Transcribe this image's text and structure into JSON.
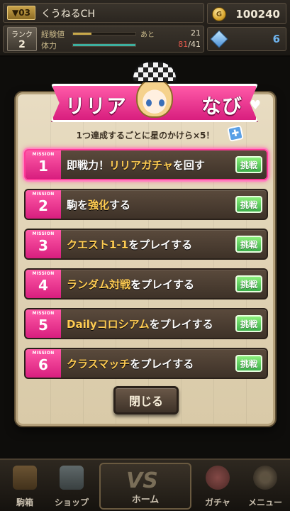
{
  "header": {
    "level": "03",
    "player_name": "くうねるCH",
    "rank_label": "ランク",
    "rank_value": "2",
    "exp_label": "経験値",
    "exp_extra": "あと",
    "exp_value": "21",
    "exp_fraction": 0.3,
    "stamina_label": "体力",
    "stamina_current": "81",
    "stamina_max": "/41",
    "stamina_fraction": 1.0,
    "coins": "100240",
    "gems": "6"
  },
  "dialog": {
    "title_left": "リリア",
    "title_right": "なび",
    "subtitle": "1つ達成するごとに星のかけら×5！",
    "missions": [
      {
        "tag": "MISSION",
        "num": "1",
        "parts": [
          "即戦力！",
          "リリアガチャ",
          "を回す"
        ],
        "button": "挑戦",
        "active": true
      },
      {
        "tag": "MISSION",
        "num": "2",
        "parts": [
          "駒を",
          "強化",
          "する"
        ],
        "button": "挑戦",
        "active": false
      },
      {
        "tag": "MISSION",
        "num": "3",
        "parts": [
          "クエスト1-1",
          "を",
          "プレイする"
        ],
        "button": "挑戦",
        "active": false
      },
      {
        "tag": "MISSION",
        "num": "4",
        "parts": [
          "ランダム対戦",
          "を",
          "プレイする"
        ],
        "button": "挑戦",
        "active": false
      },
      {
        "tag": "MISSION",
        "num": "5",
        "parts": [
          "Dailyコロシアム",
          "を",
          "プレイする"
        ],
        "button": "挑戦",
        "active": false
      },
      {
        "tag": "MISSION",
        "num": "6",
        "parts": [
          "クラスマッチ",
          "を",
          "プレイする"
        ],
        "button": "挑戦",
        "active": false
      }
    ],
    "close_label": "閉じる"
  },
  "nav": {
    "items": [
      "駒箱",
      "ショップ",
      "ホーム",
      "ガチャ",
      "メニュー"
    ],
    "home_mark": "VS"
  },
  "colors": {
    "accent_pink": "#ff3b98",
    "challenge_green": "#3db04a",
    "highlight_yellow": "#ffcc52"
  }
}
